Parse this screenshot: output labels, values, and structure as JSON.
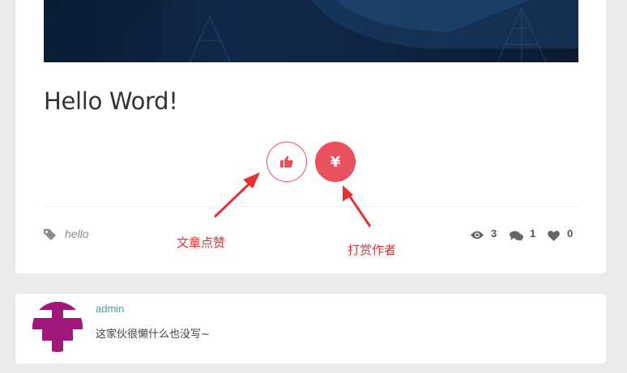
{
  "post": {
    "title": "Hello Word!",
    "tag": "hello",
    "views": "3",
    "comments": "1",
    "likes": "0"
  },
  "actions": {
    "like_icon": "thumbs-up-icon",
    "reward_symbol": "¥"
  },
  "annotations": {
    "like_label": "文章点赞",
    "reward_label": "打赏作者"
  },
  "author": {
    "name": "admin",
    "bio": "这家伙很懒什么也没写~"
  },
  "colors": {
    "accent": "#e8515d",
    "annotation": "#e4312f",
    "author_link": "#3aa3a7",
    "avatar": "#a0197a"
  }
}
